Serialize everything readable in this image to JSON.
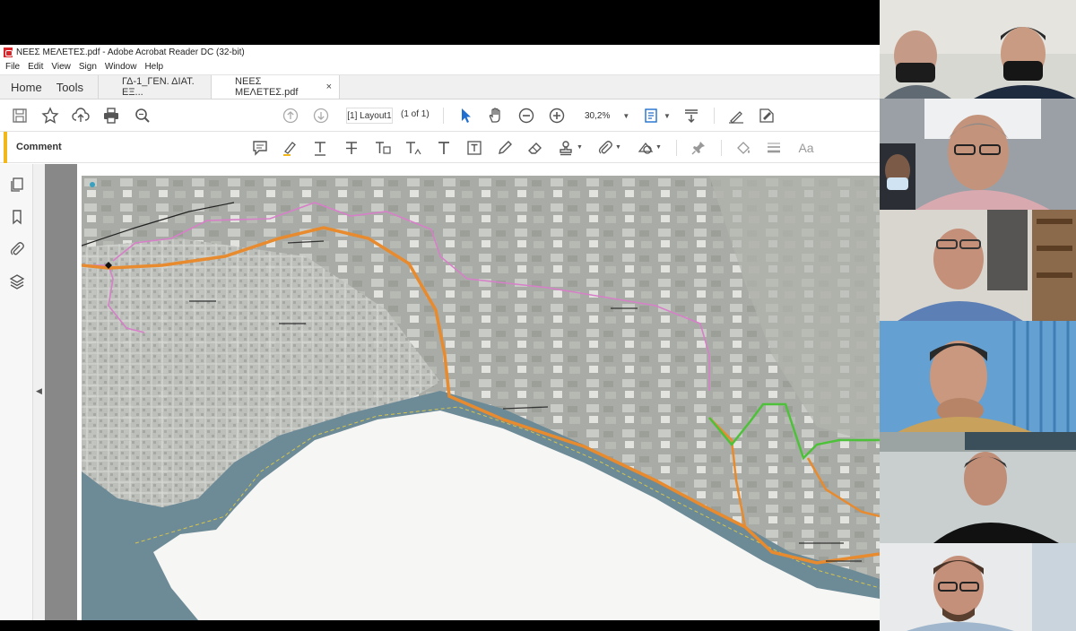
{
  "window": {
    "title": "ΝΕΕΣ ΜΕΛΕΤΕΣ.pdf - Adobe Acrobat Reader DC (32-bit)"
  },
  "menu": [
    "File",
    "Edit",
    "View",
    "Sign",
    "Window",
    "Help"
  ],
  "tabs": {
    "home": "Home",
    "tools": "Tools",
    "documents": [
      {
        "label": "ΓΔ-1_ΓΕΝ. ΔΙΑΤ. ΕΞ...",
        "active": false
      },
      {
        "label": "ΝΕΕΣ ΜΕΛΕΤΕΣ.pdf",
        "active": true
      }
    ],
    "close_glyph": "×"
  },
  "toolbar": {
    "page_label": "[1] Layout1",
    "page_count": "(1 of 1)",
    "zoom": "30,2%",
    "icons": [
      "save-icon",
      "bookmark-star-icon",
      "upload-icon",
      "print-icon",
      "zoom-search-icon",
      "prev-page-icon",
      "next-page-icon",
      "select-arrow-icon",
      "hand-icon",
      "zoom-out-icon",
      "zoom-in-icon",
      "fit-page-icon",
      "scroll-mode-icon",
      "sign-icon",
      "fill-sign-icon"
    ]
  },
  "comment_bar": {
    "label": "Comment",
    "icons": [
      "sticky-note-icon",
      "highlight-icon",
      "underline-text-icon",
      "strikethrough-text-icon",
      "replace-text-icon",
      "insert-text-icon",
      "add-text-icon",
      "text-box-icon",
      "pencil-icon",
      "eraser-icon",
      "stamp-icon",
      "attach-icon",
      "shapes-icon",
      "pin-icon",
      "fill-color-icon",
      "line-weight-icon",
      "font-size-icon"
    ]
  },
  "comment_bar_text": {
    "font_icon": "Aa"
  },
  "left_rail": {
    "icons": [
      "pages-icon",
      "bookmarks-icon",
      "attachments-icon",
      "layers-icon"
    ],
    "collapse_glyph": "◀"
  },
  "colors": {
    "route_orange": "#e88a2e",
    "route_pink": "#d77fc8",
    "route_green": "#4ec13a",
    "sea": "#6d8a97",
    "land": "#a4a8a3",
    "comment_accent": "#f2b71c"
  },
  "participants": [
    {
      "id": "tile-1",
      "people": 2
    },
    {
      "id": "tile-2",
      "people": 1
    },
    {
      "id": "tile-3",
      "people": 1
    },
    {
      "id": "tile-4",
      "people": 1
    },
    {
      "id": "tile-5",
      "people": 1
    },
    {
      "id": "tile-6",
      "people": 1
    }
  ]
}
